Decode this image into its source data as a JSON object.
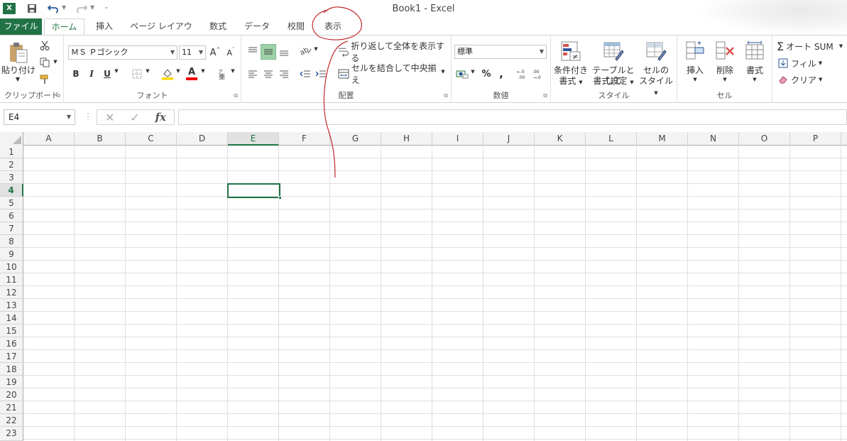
{
  "window": {
    "title": "Book1 - Excel"
  },
  "tabs": [
    {
      "label": "ファイル"
    },
    {
      "label": "ホーム"
    },
    {
      "label": "挿入"
    },
    {
      "label": "ページ レイアウト"
    },
    {
      "label": "数式"
    },
    {
      "label": "データ"
    },
    {
      "label": "校閲"
    },
    {
      "label": "表示"
    }
  ],
  "ribbon": {
    "clipboard": {
      "label": "クリップボード",
      "paste": "貼り付け"
    },
    "font": {
      "label": "フォント",
      "name": "ＭＳ Ｐゴシック",
      "size": "11",
      "grow": "A",
      "shrink": "A",
      "bold": "B",
      "italic": "I",
      "underline": "U",
      "font_color": "A"
    },
    "alignment": {
      "label": "配置",
      "wrap_text": "折り返して全体を表示する",
      "merge": "セルを結合して中央揃え"
    },
    "number": {
      "label": "数値",
      "format": "標準",
      "percent": "%",
      "comma": ","
    },
    "styles": {
      "label": "スタイル",
      "conditional": "条件付き",
      "conditional2": "書式",
      "table": "テーブルとして",
      "table2": "書式設定",
      "cell_styles": "セルの",
      "cell_styles2": "スタイル"
    },
    "cells": {
      "label": "セル",
      "insert": "挿入",
      "delete": "削除",
      "format": "書式"
    },
    "editing": {
      "autosum": "オート SUM",
      "fill": "フィル",
      "clear": "クリア",
      "label_partial": "編"
    }
  },
  "formula_bar": {
    "name_box": "E4",
    "fx": "fx",
    "value": ""
  },
  "sheet": {
    "columns": [
      "A",
      "B",
      "C",
      "D",
      "E",
      "F",
      "G",
      "H",
      "I",
      "J",
      "K",
      "L",
      "M",
      "N",
      "O",
      "P"
    ],
    "rows": [
      "1",
      "2",
      "3",
      "4",
      "5",
      "6",
      "7",
      "8",
      "9",
      "10",
      "11",
      "12",
      "13",
      "14",
      "15",
      "16",
      "17",
      "18",
      "19",
      "20",
      "21",
      "22",
      "23"
    ],
    "selected_column": "E",
    "selected_row": "4"
  },
  "colors": {
    "accent": "#217346",
    "annotation": "#c0282a"
  }
}
